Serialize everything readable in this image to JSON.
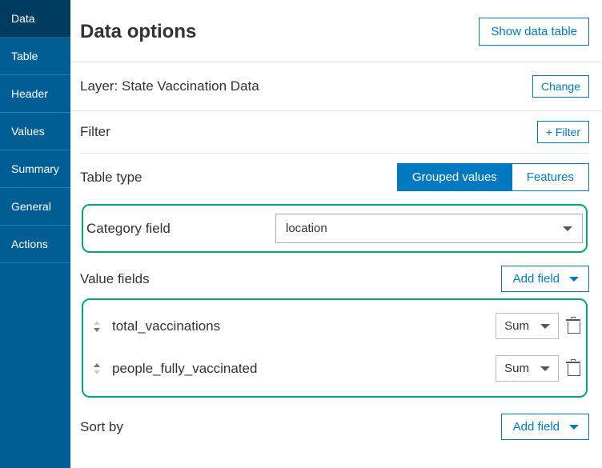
{
  "sidebar": {
    "items": [
      {
        "label": "Data",
        "active": true
      },
      {
        "label": "Table",
        "active": false
      },
      {
        "label": "Header",
        "active": false
      },
      {
        "label": "Values",
        "active": false
      },
      {
        "label": "Summary",
        "active": false
      },
      {
        "label": "General",
        "active": false
      },
      {
        "label": "Actions",
        "active": false
      }
    ]
  },
  "header": {
    "title": "Data options",
    "show_table_btn": "Show data table"
  },
  "layer": {
    "prefix": "Layer: ",
    "name": "State Vaccination Data",
    "change_btn": "Change"
  },
  "filter": {
    "label": "Filter",
    "add_btn": "+ Filter"
  },
  "table_type": {
    "label": "Table type",
    "options": [
      "Grouped values",
      "Features"
    ],
    "selected": "Grouped values"
  },
  "category_field": {
    "label": "Category field",
    "value": "location"
  },
  "value_fields": {
    "label": "Value fields",
    "add_btn": "Add field",
    "fields": [
      {
        "name": "total_vaccinations",
        "agg": "Sum"
      },
      {
        "name": "people_fully_vaccinated",
        "agg": "Sum"
      }
    ]
  },
  "sort_by": {
    "label": "Sort by",
    "add_btn": "Add field"
  }
}
